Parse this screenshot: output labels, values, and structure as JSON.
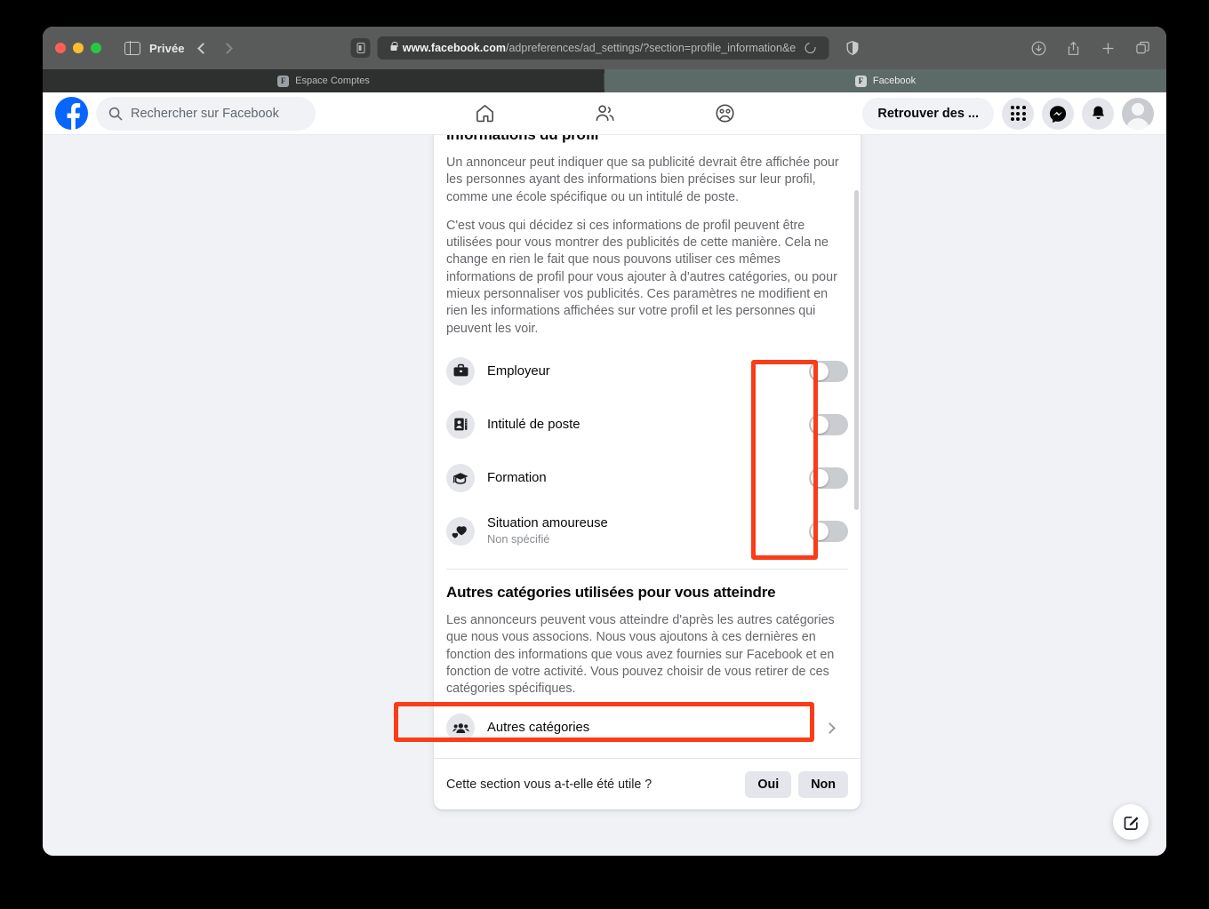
{
  "browser": {
    "mode_label": "Privée",
    "url_bold": "www.facebook.com",
    "url_rest": "/adpreferences/ad_settings/?section=profile_information&e",
    "tabs": [
      {
        "title": "Espace Comptes",
        "favicon": "F",
        "active": false
      },
      {
        "title": "Facebook",
        "favicon": "F",
        "active": true
      }
    ],
    "toolbar_icons": [
      "downloads-icon",
      "share-icon",
      "new-tab-icon",
      "tab-overview-icon"
    ],
    "nav_back_icon": "chevron-left-icon",
    "nav_forward_icon": "chevron-right-icon",
    "sidebar_icon": "sidebar-toggle-icon",
    "reload_icon": "reload-icon",
    "privacy_icon": "privacy-shield-icon",
    "lock_icon": "lock-icon"
  },
  "fb_header": {
    "logo_icon": "facebook-logo-icon",
    "search": {
      "placeholder": "Rechercher sur Facebook",
      "icon": "search-icon",
      "value": ""
    },
    "nav": [
      {
        "name": "home-icon",
        "label": "Accueil"
      },
      {
        "name": "friends-icon",
        "label": "Amis"
      },
      {
        "name": "groups-icon",
        "label": "Groupes"
      }
    ],
    "find_button": "Retrouver des ...",
    "menu_icon": "grid-menu-icon",
    "messenger_icon": "messenger-icon",
    "notifications_icon": "bell-icon",
    "avatar": "account-avatar"
  },
  "card": {
    "profile_section": {
      "title": "Informations du profil",
      "paragraphs": [
        "Un annonceur peut indiquer que sa publicité devrait être affichée pour les personnes ayant des informations bien précises sur leur profil, comme une école spécifique ou un intitulé de poste.",
        "C'est vous qui décidez si ces informations de profil peuvent être utilisées pour vous montrer des publicités de cette manière. Cela ne change en rien le fait que nous pouvons utiliser ces mêmes informations de profil pour vous ajouter à d'autres catégories, ou pour mieux personnaliser vos publicités. Ces paramètres ne modifient en rien les informations affichées sur votre profil et les personnes qui peuvent les voir."
      ],
      "rows": [
        {
          "label": "Employeur",
          "sublabel": "",
          "icon": "briefcase-icon",
          "toggle_state": "off"
        },
        {
          "label": "Intitulé de poste",
          "sublabel": "",
          "icon": "job-badge-icon",
          "toggle_state": "off"
        },
        {
          "label": "Formation",
          "sublabel": "",
          "icon": "graduation-cap-icon",
          "toggle_state": "off"
        },
        {
          "label": "Situation amoureuse",
          "sublabel": "Non spécifié",
          "icon": "hearts-icon",
          "toggle_state": "off"
        }
      ]
    },
    "other_section": {
      "title": "Autres catégories utilisées pour vous atteindre",
      "paragraph": "Les annonceurs peuvent vous atteindre d'après les autres catégories que nous vous associons. Nous vous ajoutons à ces dernières en fonction des informations que vous avez fournies sur Facebook et en fonction de votre activité. Vous pouvez choisir de vous retirer de ces catégories spécifiques.",
      "nav_row": {
        "label": "Autres catégories",
        "icon": "people-group-icon",
        "chevron": "chevron-right-icon"
      }
    },
    "feedback": {
      "question": "Cette section vous a-t-elle été utile ?",
      "yes": "Oui",
      "no": "Non"
    }
  },
  "fab": {
    "icon": "compose-pencil-icon"
  },
  "annotations": {
    "accent_color": "#fa3c18",
    "boxes": [
      {
        "name": "toggles-highlight",
        "target": "profile toggle switches column"
      },
      {
        "name": "other-categories-highlight",
        "target": "Autres catégories row"
      }
    ]
  },
  "colors": {
    "fb_blue": "#0866ff",
    "page_bg": "#f0f2f5",
    "card_bg": "#ffffff",
    "toggle_off": "#c9ccd1",
    "banner_teal": "#a7ded1",
    "text_primary": "#080809",
    "text_secondary": "#65676b"
  }
}
